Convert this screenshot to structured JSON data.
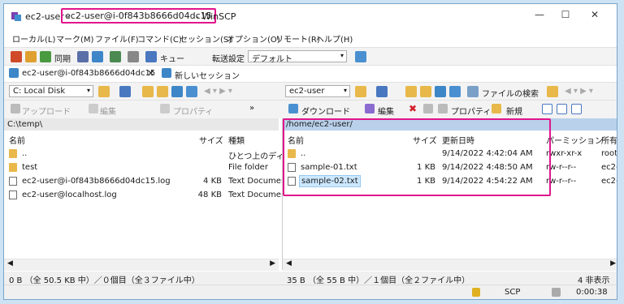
{
  "title": {
    "app_part": "ec2-user - ",
    "host_part": "ec2-user@i-0f843b8666d04dc15",
    "suffix": " - WinSCP"
  },
  "window_controls": {
    "minimize": "—",
    "maximize": "☐",
    "close": "✕"
  },
  "menu": [
    "ローカル(L)",
    "マーク(M)",
    "ファイル(F)",
    "コマンド(C)",
    "セッション(S)",
    "オプション(O)",
    "リモート(R)",
    "ヘルプ(H)"
  ],
  "toolbar": {
    "sync_label": "同期",
    "queue_label": "キュー",
    "transfer_label": "転送設定",
    "transfer_value": "デフォルト"
  },
  "tabs": {
    "session": "ec2-user@i-0f843b8666d04dc15",
    "new_session": "新しいセッション"
  },
  "local": {
    "drive": "C: Local Disk",
    "upload": "アップロード",
    "edit": "編集",
    "properties": "プロパティ",
    "path": "C:\\temp\\",
    "columns": {
      "name": "名前",
      "size": "サイズ",
      "type": "種類"
    },
    "files": [
      {
        "name": "..",
        "size": "",
        "type": "ひとつ上のディレ"
      },
      {
        "name": "test",
        "size": "",
        "type": "File folder"
      },
      {
        "name": "ec2-user@i-0f843b8666d04dc15.log",
        "size": "4 KB",
        "type": "Text Documen"
      },
      {
        "name": "ec2-user@localhost.log",
        "size": "48 KB",
        "type": "Text Documen"
      }
    ],
    "status": "0 B （全 50.5 KB 中）／０個目（全３ファイル中）"
  },
  "remote": {
    "dir": "ec2-user",
    "find": "ファイルの検索",
    "download": "ダウンロード",
    "edit": "編集",
    "properties": "プロパティ",
    "new": "新規",
    "path": "/home/ec2-user/",
    "columns": {
      "name": "名前",
      "size": "サイズ",
      "modified": "更新日時",
      "perm": "パーミッション",
      "owner": "所有"
    },
    "files": [
      {
        "name": "..",
        "size": "",
        "modified": "9/14/2022 4:42:04 AM",
        "perm": "rwxr-xr-x",
        "owner": "root"
      },
      {
        "name": "sample-01.txt",
        "size": "1 KB",
        "modified": "9/14/2022 4:48:50 AM",
        "perm": "rw-r--r--",
        "owner": "ec2-"
      },
      {
        "name": "sample-02.txt",
        "size": "1 KB",
        "modified": "9/14/2022 4:54:22 AM",
        "perm": "rw-r--r--",
        "owner": "ec2-"
      }
    ],
    "status": "35 B （全 55 B 中）／１個目（全２ファイル中）",
    "hidden": "4 非表示"
  },
  "bottom": {
    "protocol": "SCP",
    "timer": "0:00:38"
  },
  "colors": {
    "highlight": "#e0158c",
    "path_bar": "#b9d1ea",
    "selection": "#cce8ff"
  }
}
